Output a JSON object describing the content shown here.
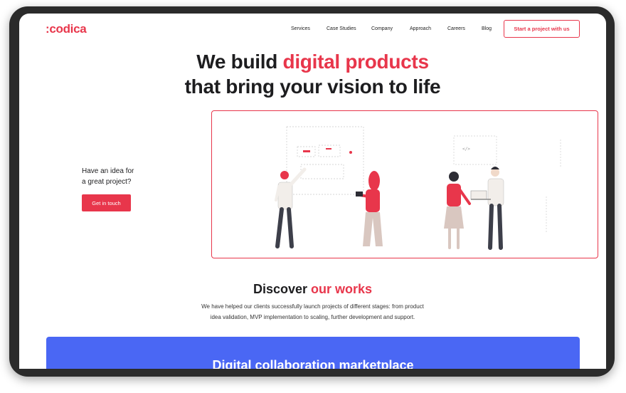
{
  "brand": {
    "logo": ":codica",
    "accent": "#e8364b",
    "banner_color": "#4a67f4"
  },
  "nav": {
    "items": [
      "Services",
      "Case Studies",
      "Company",
      "Approach",
      "Careers",
      "Blog"
    ],
    "cta": "Start a project with us"
  },
  "hero": {
    "title_line1_prefix": "We build ",
    "title_line1_accent": "digital products",
    "title_line2": "that bring your vision to life",
    "idea_line1": "Have an idea for",
    "idea_line2": "a great project?",
    "button": "Get in touch",
    "illustration_icon": "team-collaboration-illustration"
  },
  "discover": {
    "title_prefix": "Discover ",
    "title_accent": "our works",
    "desc_line1": "We have helped our clients successfully launch projects of different stages: from product",
    "desc_line2": "idea validation, MVP implementation to scaling, further development and support."
  },
  "banner": {
    "title": "Digital collaboration marketplace"
  }
}
